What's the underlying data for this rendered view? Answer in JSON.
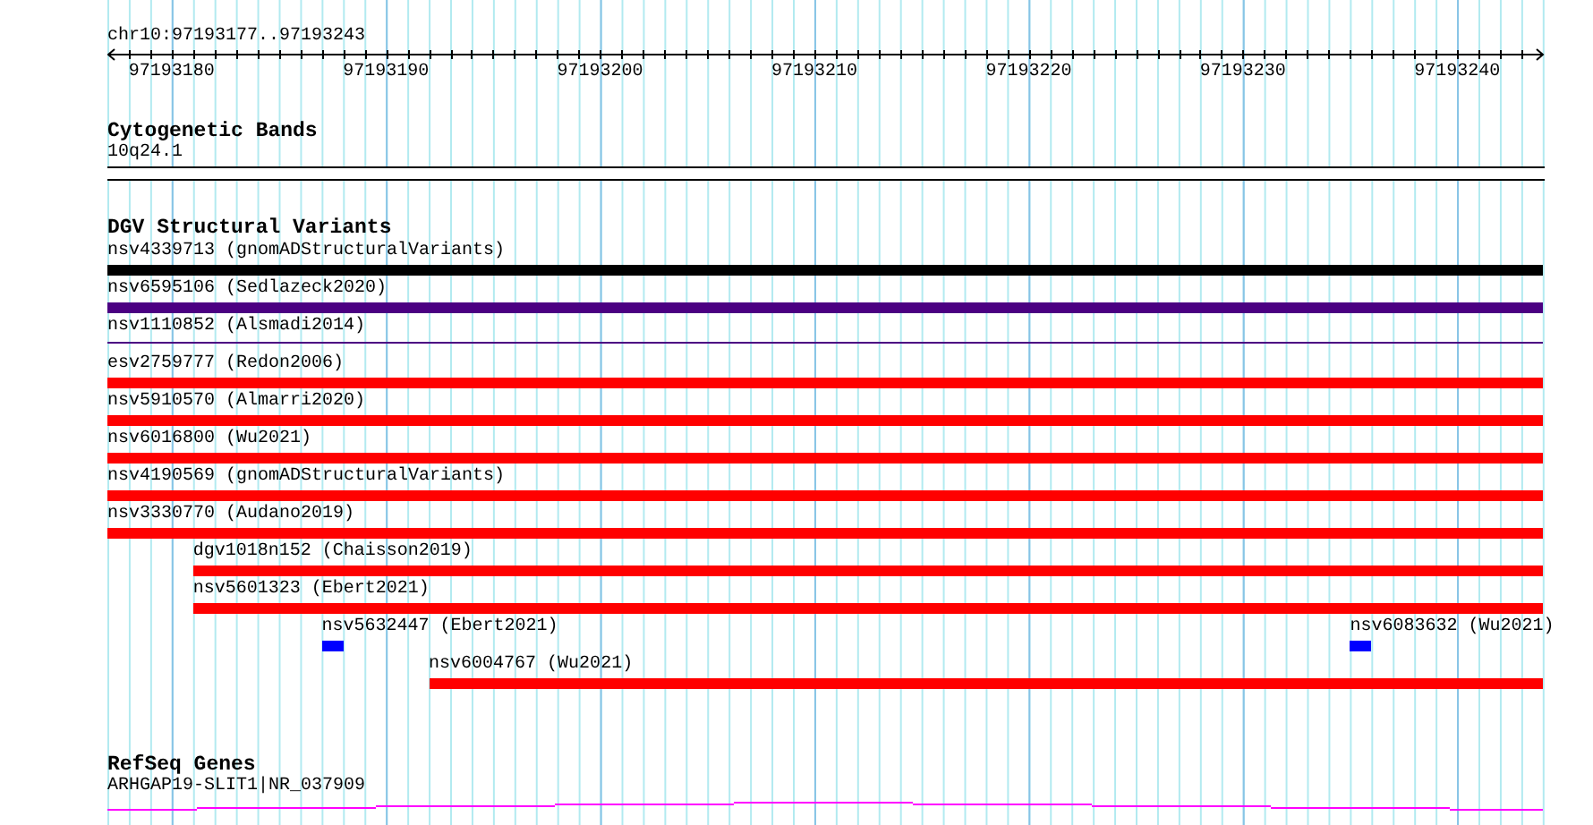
{
  "ruler": {
    "title": "chr10:97193177..97193243",
    "ticks": [
      "97193180",
      "97193190",
      "97193200",
      "97193210",
      "97193220",
      "97193230",
      "97193240"
    ]
  },
  "cytogenetic_bands": {
    "title": "Cytogenetic Bands",
    "band": "10q24.1"
  },
  "dgv_structural_variants": {
    "title": "DGV Structural Variants",
    "rows": [
      {
        "features": [
          {
            "label": "nsv4339713 (gnomADStructuralVariants)",
            "color": "#000000",
            "kind": "bar"
          }
        ]
      },
      {
        "features": [
          {
            "label": "nsv6595106 (Sedlazeck2020)",
            "color": "#4b0082",
            "kind": "bar"
          }
        ]
      },
      {
        "features": [
          {
            "label": "nsv1110852 (Alsmadi2014)",
            "color": "#4b0082",
            "kind": "line"
          }
        ]
      },
      {
        "features": [
          {
            "label": "esv2759777 (Redon2006)",
            "color": "#ff0000",
            "kind": "bar"
          }
        ]
      },
      {
        "features": [
          {
            "label": "nsv5910570 (Almarri2020)",
            "color": "#ff0000",
            "kind": "bar"
          }
        ]
      },
      {
        "features": [
          {
            "label": "nsv6016800 (Wu2021)",
            "color": "#ff0000",
            "kind": "bar"
          }
        ]
      },
      {
        "features": [
          {
            "label": "nsv4190569 (gnomADStructuralVariants)",
            "color": "#ff0000",
            "kind": "bar"
          }
        ]
      },
      {
        "features": [
          {
            "label": "nsv3330770 (Audano2019)",
            "color": "#ff0000",
            "kind": "bar"
          }
        ]
      },
      {
        "features": [
          {
            "label": "dgv1018n152 (Chaisson2019)",
            "color": "#ff0000",
            "kind": "bar"
          }
        ]
      },
      {
        "features": [
          {
            "label": "nsv5601323 (Ebert2021)",
            "color": "#ff0000",
            "kind": "bar"
          }
        ]
      },
      {
        "features": [
          {
            "label": "nsv5632447 (Ebert2021)",
            "color": "#0000ff",
            "kind": "bar"
          },
          {
            "label": "nsv6083632 (Wu2021)",
            "color": "#0000ff",
            "kind": "bar"
          }
        ]
      },
      {
        "features": [
          {
            "label": "nsv6004767 (Wu2021)",
            "color": "#ff0000",
            "kind": "bar"
          }
        ]
      }
    ]
  },
  "refseq_genes": {
    "title": "RefSeq Genes",
    "gene": "ARHGAP19-SLIT1|NR_037909"
  }
}
